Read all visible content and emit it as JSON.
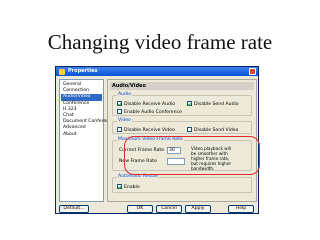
{
  "slide": {
    "title": "Changing video frame rate"
  },
  "window": {
    "title": "Properties"
  },
  "tree": {
    "items": [
      {
        "label": "General",
        "selected": false
      },
      {
        "label": "Connection",
        "selected": false
      },
      {
        "label": "Audio/Video",
        "selected": true
      },
      {
        "label": "Conference",
        "selected": false
      },
      {
        "label": "H.323",
        "selected": false
      },
      {
        "label": "Chat",
        "selected": false
      },
      {
        "label": "Document Conference",
        "selected": false
      },
      {
        "label": "Advanced",
        "selected": false
      },
      {
        "label": "About",
        "selected": false
      }
    ]
  },
  "panel": {
    "header": "Audio/Video",
    "audio": {
      "title": "Audio",
      "disable_receive": {
        "label": "Disable Receive Audio",
        "checked": true
      },
      "disable_send": {
        "label": "Disable Send Audio",
        "checked": true
      },
      "enable_conference": {
        "label": "Enable Audio Conference",
        "checked": false
      }
    },
    "video": {
      "title": "Video",
      "disable_receive": {
        "label": "Disable Receive Video",
        "checked": false
      },
      "disable_send": {
        "label": "Disable Send Video",
        "checked": false
      }
    },
    "frame_rate": {
      "title": "Maximum Video Frame Rate",
      "current_label": "Current Frame Rate",
      "current_value": "30",
      "new_label": "New Frame Rate",
      "new_value": "",
      "note": "Video playback will be smoother with higher frame rate, but requires higher bandwidth."
    },
    "auto_resize": {
      "title": "Automatic Resize",
      "enable": {
        "label": "Enable",
        "checked": true
      }
    }
  },
  "buttons": {
    "default": "Default...",
    "ok": "OK",
    "cancel": "Cancel",
    "apply": "Apply",
    "help": "Help"
  },
  "colors": {
    "highlight": "#e02a2a",
    "titlebar": "#0a54d4",
    "selection": "#316ac5"
  }
}
